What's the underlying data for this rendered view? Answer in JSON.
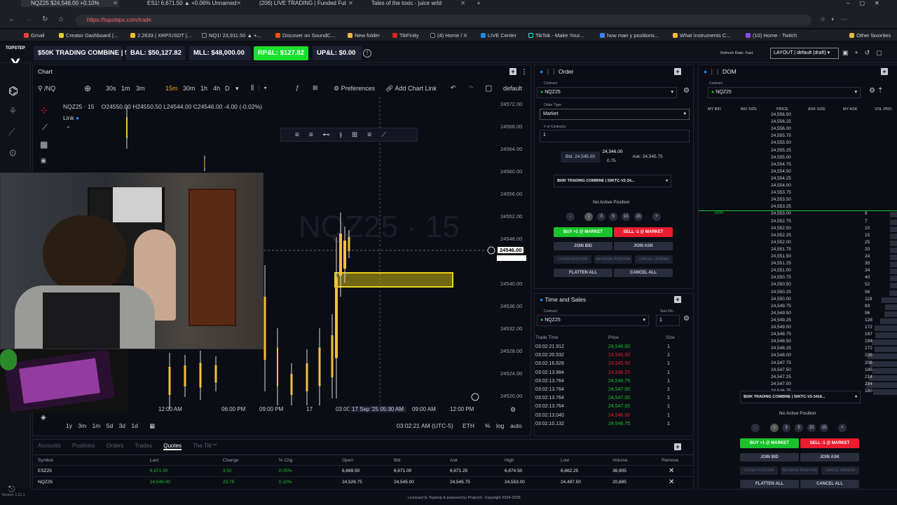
{
  "browser": {
    "tabs": [
      {
        "label": "NQZ25 $24,546.00 +0.10%"
      },
      {
        "label": "ES1! 6,671.50 ▲ +0.06% Unnamed"
      },
      {
        "label": "(206) LIVE TRADING | Funded Fut"
      },
      {
        "label": "Tales of the toxic - juice wrld"
      }
    ],
    "url": "https://topstepx.com/trade",
    "bookmarks": [
      "Gmail",
      "Creator Dashboard |...",
      "2.2633 | XRP/USDT |...",
      "NQ1! 23,911.50 ▲ +...",
      "Discover on SoundC...",
      "New folder",
      "TikFinity",
      "(4) Home / X",
      "LIVE Center",
      "TikTok - Make Your...",
      "how man y positions...",
      "What Instruments C...",
      "(10) Home - Twitch",
      "Other favorites"
    ]
  },
  "header": {
    "logo": "TOPSTEP",
    "account": "$50K TRADING COMBINE | 5...",
    "bal": "BAL: $50,127.82",
    "mll": "MLL: $48,000.00",
    "rpl": "RP&L: $127.82",
    "upl": "UP&L: $0.00",
    "refresh": "Refresh Rate: Fast",
    "layout": "LAYOUT | default (draft)"
  },
  "chart": {
    "tab": "Chart",
    "symbol_search": "/NQ",
    "timeframes": [
      "30s",
      "1m",
      "3m",
      "15m",
      "30m",
      "1h",
      "4h",
      "D"
    ],
    "preferences": "Preferences",
    "add_link": "Add Chart Link",
    "template": "default",
    "legend_symbol": "NQZ25 · 15",
    "legend_ohlc": "O24550.00 H24550.50 L24544.00 C24546.00 -4.00 (-0.02%)",
    "legend_link": "Link",
    "price_labels": [
      "24572.00",
      "24568.00",
      "24564.00",
      "24560.00",
      "24556.00",
      "24552.00",
      "24548.00",
      "24546.00",
      "24540.00",
      "24536.00",
      "24532.00",
      "24528.00",
      "24524.00",
      "24520.00"
    ],
    "time_labels": [
      "12:00 AM",
      "06:00 PM",
      "09:00 PM",
      "17",
      "03:00",
      "09:00 AM",
      "12:00 PM"
    ],
    "crosshair_time": "17 Sep '25  05:30 AM",
    "ranges": [
      "1y",
      "3m",
      "1m",
      "5d",
      "3d",
      "1d"
    ],
    "clock": "03:02:21 AM (UTC-5)",
    "session": "ETH",
    "scale_opts": [
      "%",
      "log",
      "auto"
    ],
    "watermark": "NQZ25 · 15"
  },
  "order": {
    "title": "Order",
    "contract_label": "Contract",
    "contract": "NQZ25",
    "order_type_label": "Order Type",
    "order_type": "Market",
    "contracts_label": "# of Contracts",
    "contracts": "1",
    "bid": "Bid: 24,545.00",
    "last": "24,546.00",
    "spread": "0.75",
    "ask": "Ask: 24,545.75",
    "account": "$50K TRADING COMBINE | 50KTC-V2-34...",
    "position": "No Active Position",
    "qty_buttons": [
      "-",
      "1",
      "3",
      "5",
      "10",
      "15",
      "+"
    ],
    "buy": "BUY +1 @ MARKET",
    "sell": "SELL -1 @ MARKET",
    "join_bid": "JOIN BID",
    "join_ask": "JOIN ASK",
    "close_pos": "CLOSE POSITION",
    "reverse": "REVERSE POSITION",
    "cancel_orders": "CANCEL ORDERS",
    "flatten": "FLATTEN ALL",
    "cancel_all": "CANCEL ALL"
  },
  "time_sales": {
    "title": "Time and Sales",
    "contract_label": "Contract",
    "contract": "NQZ25",
    "size_filter_label": "Size Filt...",
    "size_filter": "1",
    "headers": [
      "Trade Time",
      "Price",
      "Size"
    ],
    "rows": [
      {
        "time": "03:02:21.912",
        "price": "24,546.00",
        "size": "1",
        "side": "buy"
      },
      {
        "time": "03:02:20.532",
        "price": "24,545.50",
        "size": "1",
        "side": "sell"
      },
      {
        "time": "03:02:16.828",
        "price": "24,545.50",
        "size": "1",
        "side": "sell"
      },
      {
        "time": "03:02:13.984",
        "price": "24,546.25",
        "size": "1",
        "side": "sell"
      },
      {
        "time": "03:02:13.764",
        "price": "24,546.75",
        "size": "1",
        "side": "buy"
      },
      {
        "time": "03:02:13.764",
        "price": "24,547.00",
        "size": "1",
        "side": "buy"
      },
      {
        "time": "03:02:13.764",
        "price": "24,547.00",
        "size": "1",
        "side": "buy"
      },
      {
        "time": "03:02:13.764",
        "price": "24,547.00",
        "size": "1",
        "side": "buy"
      },
      {
        "time": "03:02:13.040",
        "price": "24,546.00",
        "size": "1",
        "side": "sell"
      },
      {
        "time": "03:02:10.132",
        "price": "24,546.75",
        "size": "1",
        "side": "buy"
      }
    ]
  },
  "dom": {
    "title": "DOM",
    "contract_label": "Contract",
    "contract": "NQZ25",
    "headers": [
      "MY BID",
      "BID SIZE",
      "PRICE",
      "ASK SIZE",
      "MY ASK",
      "VOL PRO."
    ],
    "hod": "HOD",
    "rows": [
      {
        "price": "24,556.50",
        "vol": ""
      },
      {
        "price": "24,556.25",
        "vol": ""
      },
      {
        "price": "24,556.00",
        "vol": ""
      },
      {
        "price": "24,555.75",
        "vol": ""
      },
      {
        "price": "24,555.50",
        "vol": ""
      },
      {
        "price": "24,555.25",
        "vol": ""
      },
      {
        "price": "24,555.00",
        "vol": ""
      },
      {
        "price": "24,554.75",
        "vol": ""
      },
      {
        "price": "24,554.50",
        "vol": ""
      },
      {
        "price": "24,554.25",
        "vol": ""
      },
      {
        "price": "24,554.00",
        "vol": ""
      },
      {
        "price": "24,553.75",
        "vol": ""
      },
      {
        "price": "24,553.50",
        "vol": ""
      },
      {
        "price": "24,553.25",
        "vol": ""
      },
      {
        "price": "24,553.00",
        "vol": "9"
      },
      {
        "price": "24,552.75",
        "vol": "7"
      },
      {
        "price": "24,552.50",
        "vol": "10"
      },
      {
        "price": "24,552.25",
        "vol": "15"
      },
      {
        "price": "24,552.00",
        "vol": "25"
      },
      {
        "price": "24,551.75",
        "vol": "20"
      },
      {
        "price": "24,551.50",
        "vol": "24"
      },
      {
        "price": "24,551.25",
        "vol": "30"
      },
      {
        "price": "24,551.00",
        "vol": "34"
      },
      {
        "price": "24,550.75",
        "vol": "40"
      },
      {
        "price": "24,550.50",
        "vol": "52"
      },
      {
        "price": "24,550.25",
        "vol": "56"
      },
      {
        "price": "24,550.00",
        "vol": "119"
      },
      {
        "price": "24,549.75",
        "vol": "93"
      },
      {
        "price": "24,549.50",
        "vol": "96"
      },
      {
        "price": "24,549.25",
        "vol": "128"
      },
      {
        "price": "24,549.00",
        "vol": "172"
      },
      {
        "price": "24,548.75",
        "vol": "167"
      },
      {
        "price": "24,548.50",
        "vol": "194"
      },
      {
        "price": "24,548.25",
        "vol": "172"
      },
      {
        "price": "24,548.00",
        "vol": "226"
      },
      {
        "price": "24,547.75",
        "vol": "206"
      },
      {
        "price": "24,547.50",
        "vol": "185"
      },
      {
        "price": "24,547.25",
        "vol": "214"
      },
      {
        "price": "24,547.00",
        "vol": "234"
      },
      {
        "price": "24,546.75",
        "vol": "180"
      }
    ],
    "account": "$50K TRADING COMBINE | 50KTC-V2-3416...",
    "position": "No Active Position",
    "qty_buttons": [
      "-",
      "1",
      "3",
      "5",
      "10",
      "15",
      "+"
    ],
    "buy": "BUY +1 @ MARKET",
    "sell": "SELL -1 @ MARKET",
    "join_bid": "JOIN BID",
    "join_ask": "JOIN ASK",
    "close_pos": "CLOSE POSITION",
    "reverse": "REVERSE POSITION",
    "cancel_orders": "CANCEL ORDERS",
    "flatten": "FLATTEN ALL",
    "cancel_all": "CANCEL ALL"
  },
  "bottom": {
    "tabs": [
      "Accounts",
      "Positions",
      "Orders",
      "Trades",
      "Quotes",
      "The Tilt™"
    ],
    "active_tab": "Quotes",
    "headers": [
      "Symbol",
      "Last",
      "Change",
      "% Chg",
      "Open",
      "Bid",
      "Ask",
      "High",
      "Low",
      "Volume",
      "Remove"
    ],
    "rows": [
      {
        "symbol": "ESZ25",
        "last": "6,671.00",
        "change": "3.50",
        "pct": "0.05%",
        "open": "6,669.50",
        "bid": "6,671.00",
        "ask": "6,671.25",
        "high": "6,674.50",
        "low": "6,662.25",
        "volume": "36,905"
      },
      {
        "symbol": "NQZ25",
        "last": "24,546.00",
        "change": "23.75",
        "pct": "0.10%",
        "open": "24,526.75",
        "bid": "24,545.00",
        "ask": "24,545.75",
        "high": "24,553.00",
        "low": "24,497.50",
        "volume": "20,685"
      }
    ],
    "version": "Version: 1.21.1",
    "footer": "Licensed to Topstep & powered by ProjectX. Copyright 2024-2025"
  },
  "colors": {
    "green": "#19c32b",
    "red": "#ea1c2e",
    "candle": "#f0c040",
    "accent": "#ff6b2b"
  }
}
